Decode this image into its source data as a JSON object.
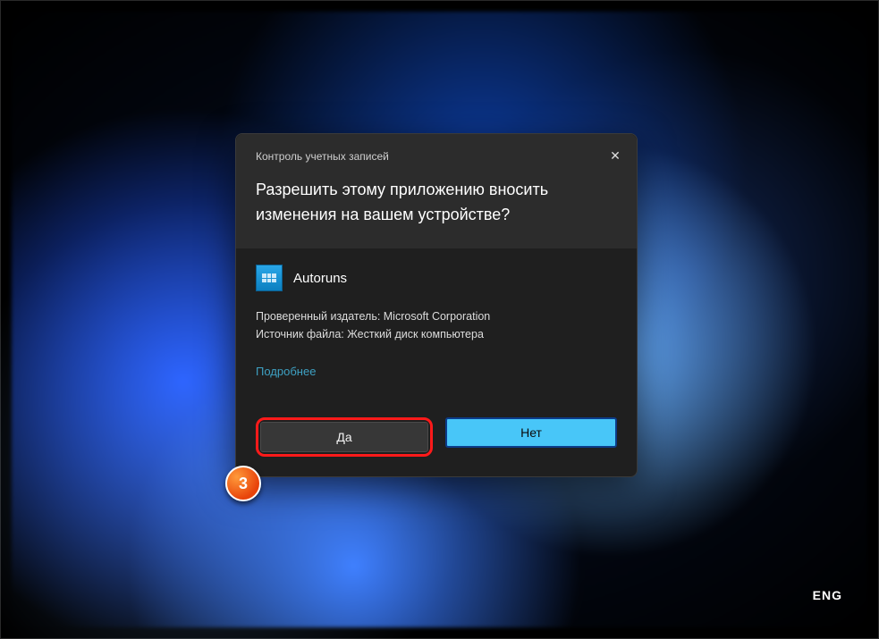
{
  "uac": {
    "title": "Контроль учетных записей",
    "question": "Разрешить этому приложению вносить изменения на вашем устройстве?",
    "app_name": "Autoruns",
    "publisher_line": "Проверенный издатель: Microsoft Corporation",
    "source_line": "Источник файла: Жесткий диск компьютера",
    "details": "Подробнее",
    "yes": "Да",
    "no": "Нет"
  },
  "annotation": {
    "step": "3"
  },
  "system": {
    "language_indicator": "ENG"
  }
}
